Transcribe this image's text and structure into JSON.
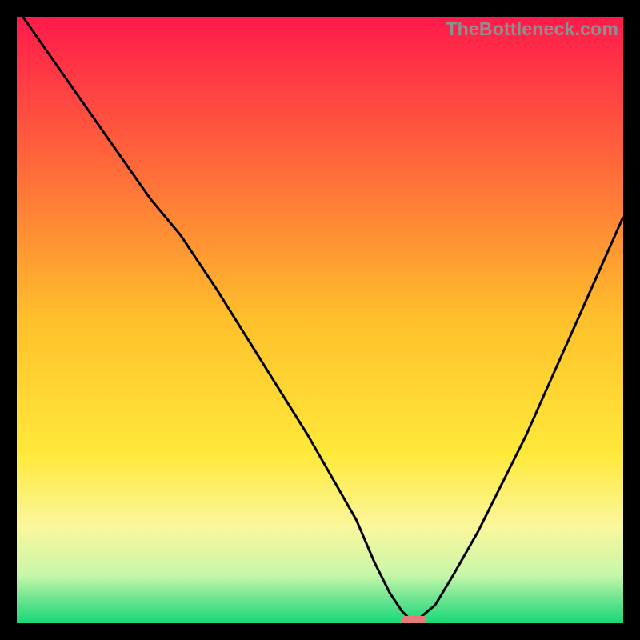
{
  "watermark": "TheBottleneck.com",
  "chart_data": {
    "type": "line",
    "title": "",
    "xlabel": "",
    "ylabel": "",
    "xlim": [
      0,
      100
    ],
    "ylim": [
      0,
      100
    ],
    "grid": false,
    "legend": false,
    "background_gradient": {
      "stops": [
        {
          "offset": 0.0,
          "color": "#ff1a4b"
        },
        {
          "offset": 0.25,
          "color": "#ff6a3a"
        },
        {
          "offset": 0.5,
          "color": "#ffc02b"
        },
        {
          "offset": 0.72,
          "color": "#ffe93a"
        },
        {
          "offset": 0.84,
          "color": "#fbf79c"
        },
        {
          "offset": 0.92,
          "color": "#c8f7a9"
        },
        {
          "offset": 0.965,
          "color": "#62e28e"
        },
        {
          "offset": 1.0,
          "color": "#17d977"
        }
      ]
    },
    "series": [
      {
        "name": "bottleneck-curve",
        "color": "#000000",
        "x": [
          1,
          8,
          15,
          22,
          27,
          33,
          38,
          43,
          48,
          52,
          56,
          59,
          61.5,
          63.5,
          65,
          66,
          69,
          72,
          76,
          80,
          84,
          88,
          92,
          96,
          100
        ],
        "y": [
          100,
          90,
          80,
          70,
          64,
          55,
          47,
          39,
          31,
          24,
          17,
          10,
          5,
          2,
          0.5,
          0.5,
          3,
          8,
          15,
          23,
          31,
          40,
          49,
          58,
          67
        ]
      }
    ],
    "marker": {
      "name": "optimal-zone-marker",
      "color": "#e77a7a",
      "x_center": 65.5,
      "y": 0.5,
      "width": 4.2,
      "height": 1.4
    }
  }
}
